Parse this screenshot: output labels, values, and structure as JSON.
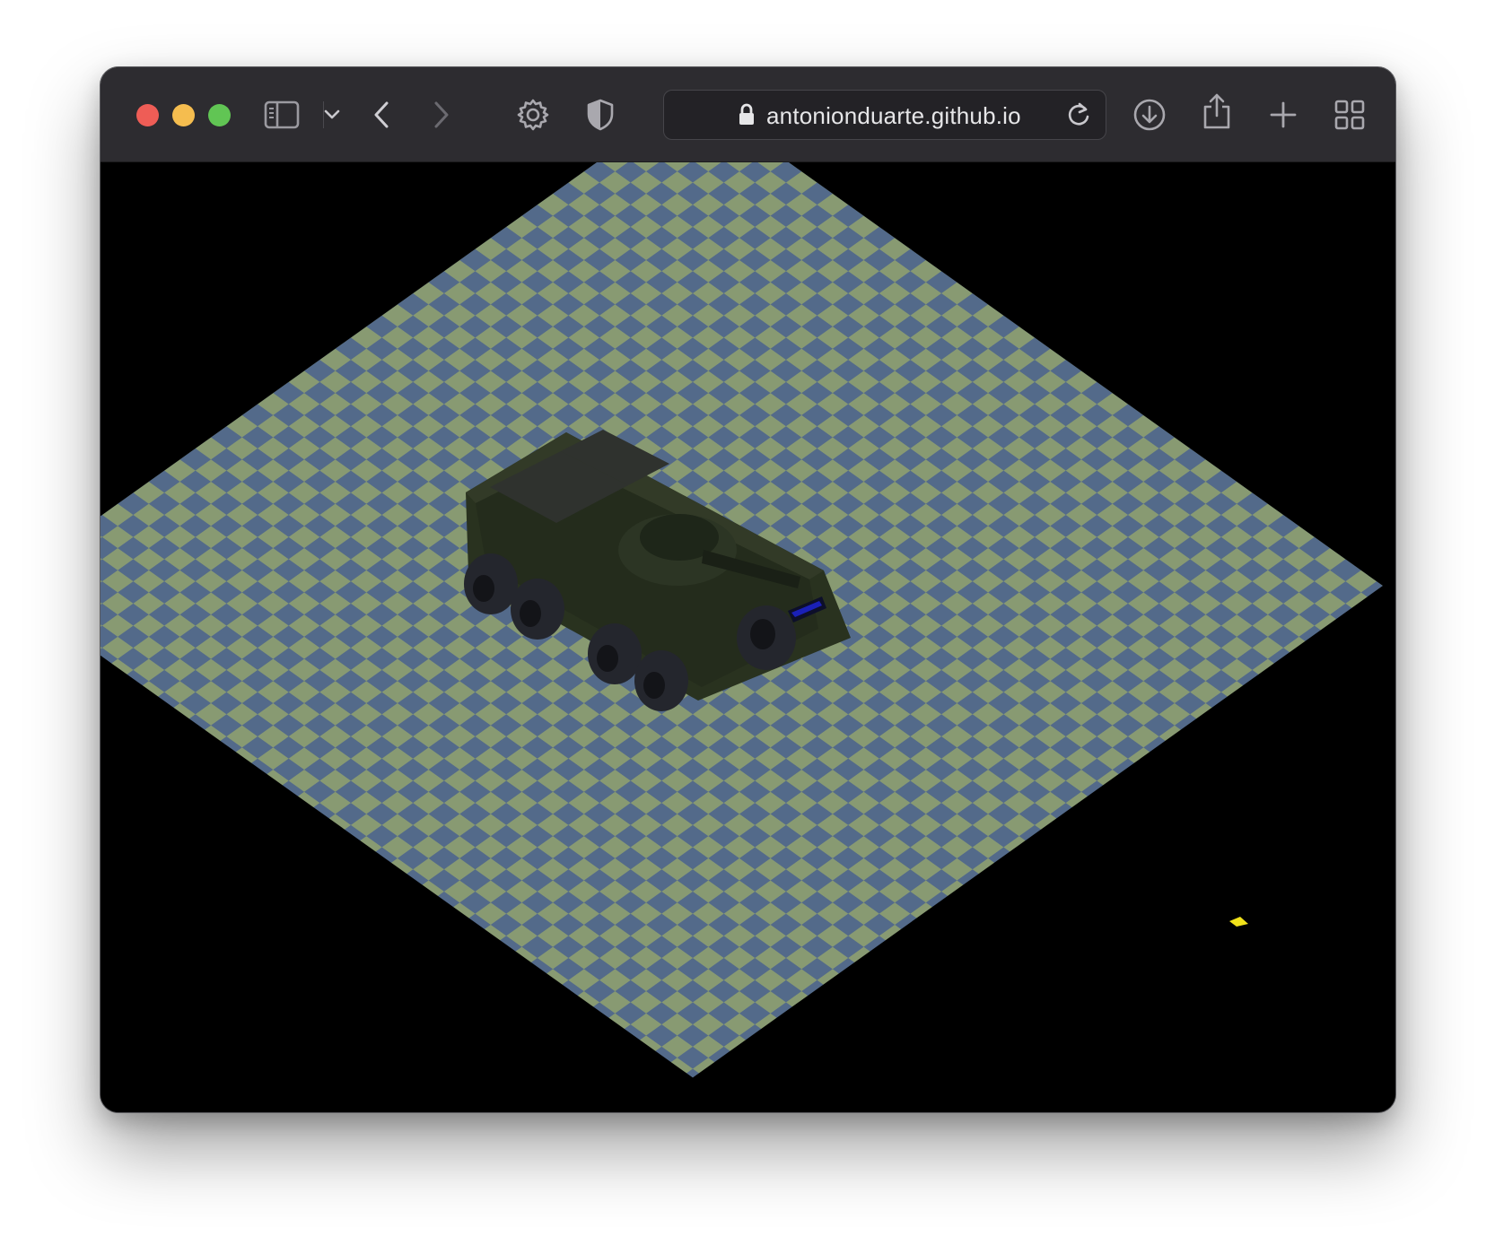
{
  "browser": {
    "url": "antonionduarte.github.io",
    "traffic_lights": {
      "close": "#ee5d56",
      "minimize": "#f5bd4f",
      "zoom": "#61c554"
    },
    "toolbar_icons": [
      "sidebar-icon",
      "chevron-down-icon",
      "back-arrow-icon",
      "forward-arrow-icon",
      "gear-icon",
      "shield-icon",
      "lock-icon",
      "reload-icon",
      "download-icon",
      "share-icon",
      "plus-icon",
      "tab-overview-icon"
    ]
  },
  "scene": {
    "floor_colors": {
      "light": "#889a72",
      "dark": "#536a8a"
    },
    "vehicle": "armored-vehicle",
    "vehicle_colors": {
      "hull": "#29321f",
      "roof": "#1f271a",
      "panel": "#2e322b",
      "wheel": "#24262d",
      "hub": "#131418",
      "light": "#1a20b8"
    },
    "marker_color": "#f1e21a",
    "background": "#000000"
  }
}
